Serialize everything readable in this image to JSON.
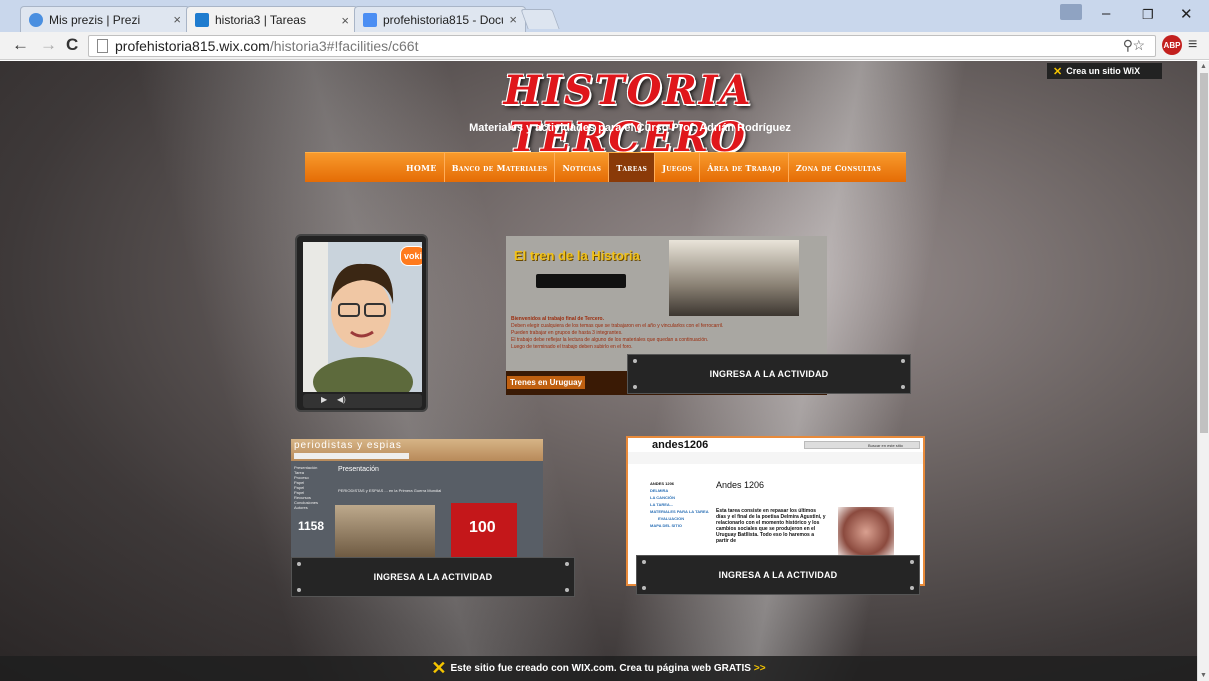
{
  "browser": {
    "tabs": [
      {
        "label": "Mis prezis | Prezi",
        "close": "×",
        "active": false,
        "fav_color": "#4a8fe0"
      },
      {
        "label": "historia3 | Tareas",
        "close": "×",
        "active": true,
        "fav_color": "#1f7ccf"
      },
      {
        "label": "profehistoria815 - Docum",
        "close": "×",
        "active": false,
        "fav_color": "#4b8ef3"
      }
    ],
    "url_host": "profehistoria815.wix.com",
    "url_path": "/historia3#!facilities/c66t",
    "abp_label": "ABP",
    "icons": [
      "back-icon",
      "forward-icon",
      "reload-icon",
      "page-icon",
      "zoom-icon",
      "star-icon",
      "menu-icon"
    ]
  },
  "site": {
    "title": "HISTORIA TERCERO",
    "subtitle": "Materiales y actividades para el Curso  Prof. Adrián Rodríguez",
    "wix_badge": "Crea un sitio WiX",
    "nav": [
      {
        "label": "HOME",
        "active": false
      },
      {
        "label": "Banco de Materiales",
        "active": false
      },
      {
        "label": "Noticias",
        "active": false
      },
      {
        "label": "Tareas",
        "active": true
      },
      {
        "label": "Juegos",
        "active": false
      },
      {
        "label": "Área de Trabajo",
        "active": false
      },
      {
        "label": "Zona de Consultas",
        "active": false
      }
    ],
    "accent": "#f08a1c",
    "voki_bubble": "voki"
  },
  "cards": {
    "tren": {
      "title": "El tren de la Historia",
      "intro": "Bienvenidos al trabajo final de Tercero.",
      "bullets": [
        "Deben elegir cualquiera de los temas que se trabajaron en el año y vincularlos con el ferrocarril.",
        "Pueden trabajar en grupos de hasta 3 integrantes.",
        "El trabajo debe reflejar la lectura de alguno de los materiales que quedan a continuación.",
        "Luego de terminado el trabajo deben subirlo en el foro."
      ],
      "footer": "Trenes en Uruguay",
      "button": "INGRESA A LA ACTIVIDAD"
    },
    "periodistas": {
      "name": "periodistas y espias",
      "heading": "Presentación",
      "side": [
        "Presentación",
        "Tarea",
        "Proceso",
        "Papel",
        "Papel",
        "Papel",
        "Recursos",
        "Conclusiones",
        "Autores"
      ],
      "sub": "PERIODISTAS y ESPIAS ... en la Primera Guerra Mundial",
      "count": "1158",
      "badge": "100",
      "button": "INGRESA A LA ACTIVIDAD"
    },
    "andes": {
      "name": "andes1206",
      "search_button": "Buscar en este sitio",
      "heading": "Andes 1206",
      "side": [
        "ANDES 1206",
        "DELMIRA",
        "LA CANCIÓN",
        "LA TAREA...",
        "MATERIALES PARA LA TAREA",
        "EVALUACION",
        "MAPA DEL SITIO"
      ],
      "body": "Esta tarea consiste en repasar los últimos días y el final de la poetisa Delmira Agustini, y relacionarlo con el momento histórico y los cambios sociales que se produjeron en el Uruguay Batllista. Todo eso lo haremos a partir de",
      "button": "INGRESA A LA ACTIVIDAD"
    }
  },
  "footer": {
    "text": "Este sitio fue creado con WIX.com. Crea tu página web GRATIS",
    "arrows": ">>"
  }
}
